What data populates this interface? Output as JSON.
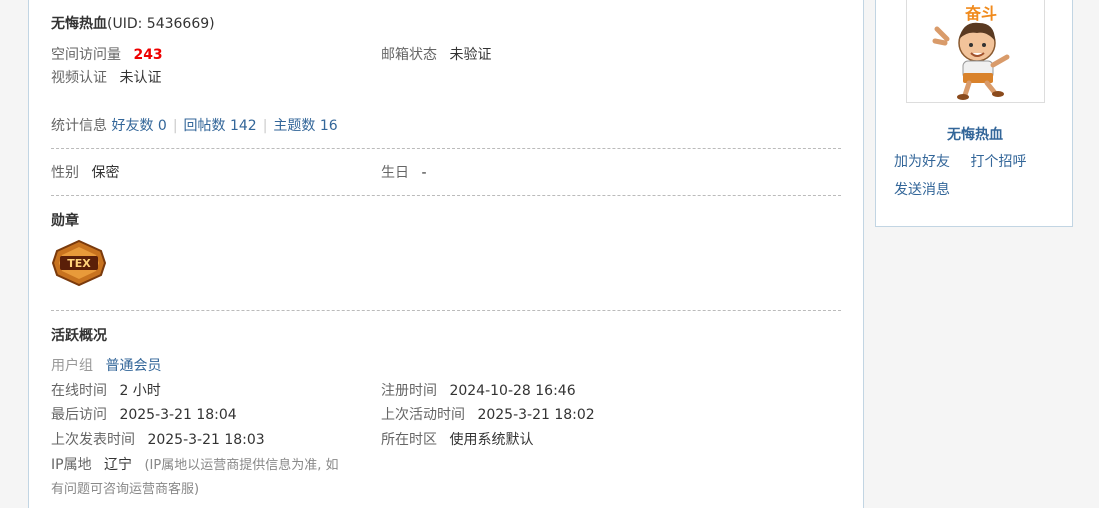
{
  "profile": {
    "username": "无悔热血",
    "uid_text": "(UID: 5436669)"
  },
  "basic": {
    "visits_label": "空间访问量",
    "visits_value": "243",
    "email_label": "邮箱状态",
    "email_value": "未验证",
    "video_label": "视频认证",
    "video_value": "未认证"
  },
  "stats": {
    "label": "统计信息",
    "friends": "好友数 0",
    "replies": "回帖数 142",
    "threads": "主题数 16",
    "separator": "|"
  },
  "personal": {
    "gender_label": "性别",
    "gender_value": "保密",
    "birthday_label": "生日",
    "birthday_value": "-"
  },
  "medals": {
    "heading": "勋章",
    "badge_text": "TEX"
  },
  "activity": {
    "heading": "活跃概况",
    "group_label": "用户组",
    "group_value": "普通会员",
    "online_label": "在线时间",
    "online_value": "2 小时",
    "register_label": "注册时间",
    "register_value": "2024-10-28 16:46",
    "last_visit_label": "最后访问",
    "last_visit_value": "2025-3-21 18:04",
    "last_active_label": "上次活动时间",
    "last_active_value": "2025-3-21 18:02",
    "last_post_label": "上次发表时间",
    "last_post_value": "2025-3-21 18:03",
    "timezone_label": "所在时区",
    "timezone_value": "使用系统默认",
    "ip_label": "IP属地",
    "ip_value": "辽宁",
    "ip_note_line1": "(IP属地以运营商提供信息为准, 如",
    "ip_note_line2": "有问题可咨询运营商客服)"
  },
  "sidebar": {
    "avatar_caption": "奋斗",
    "username": "无悔热血",
    "add_friend": "加为好友",
    "greet": "打个招呼",
    "message": "发送消息"
  }
}
